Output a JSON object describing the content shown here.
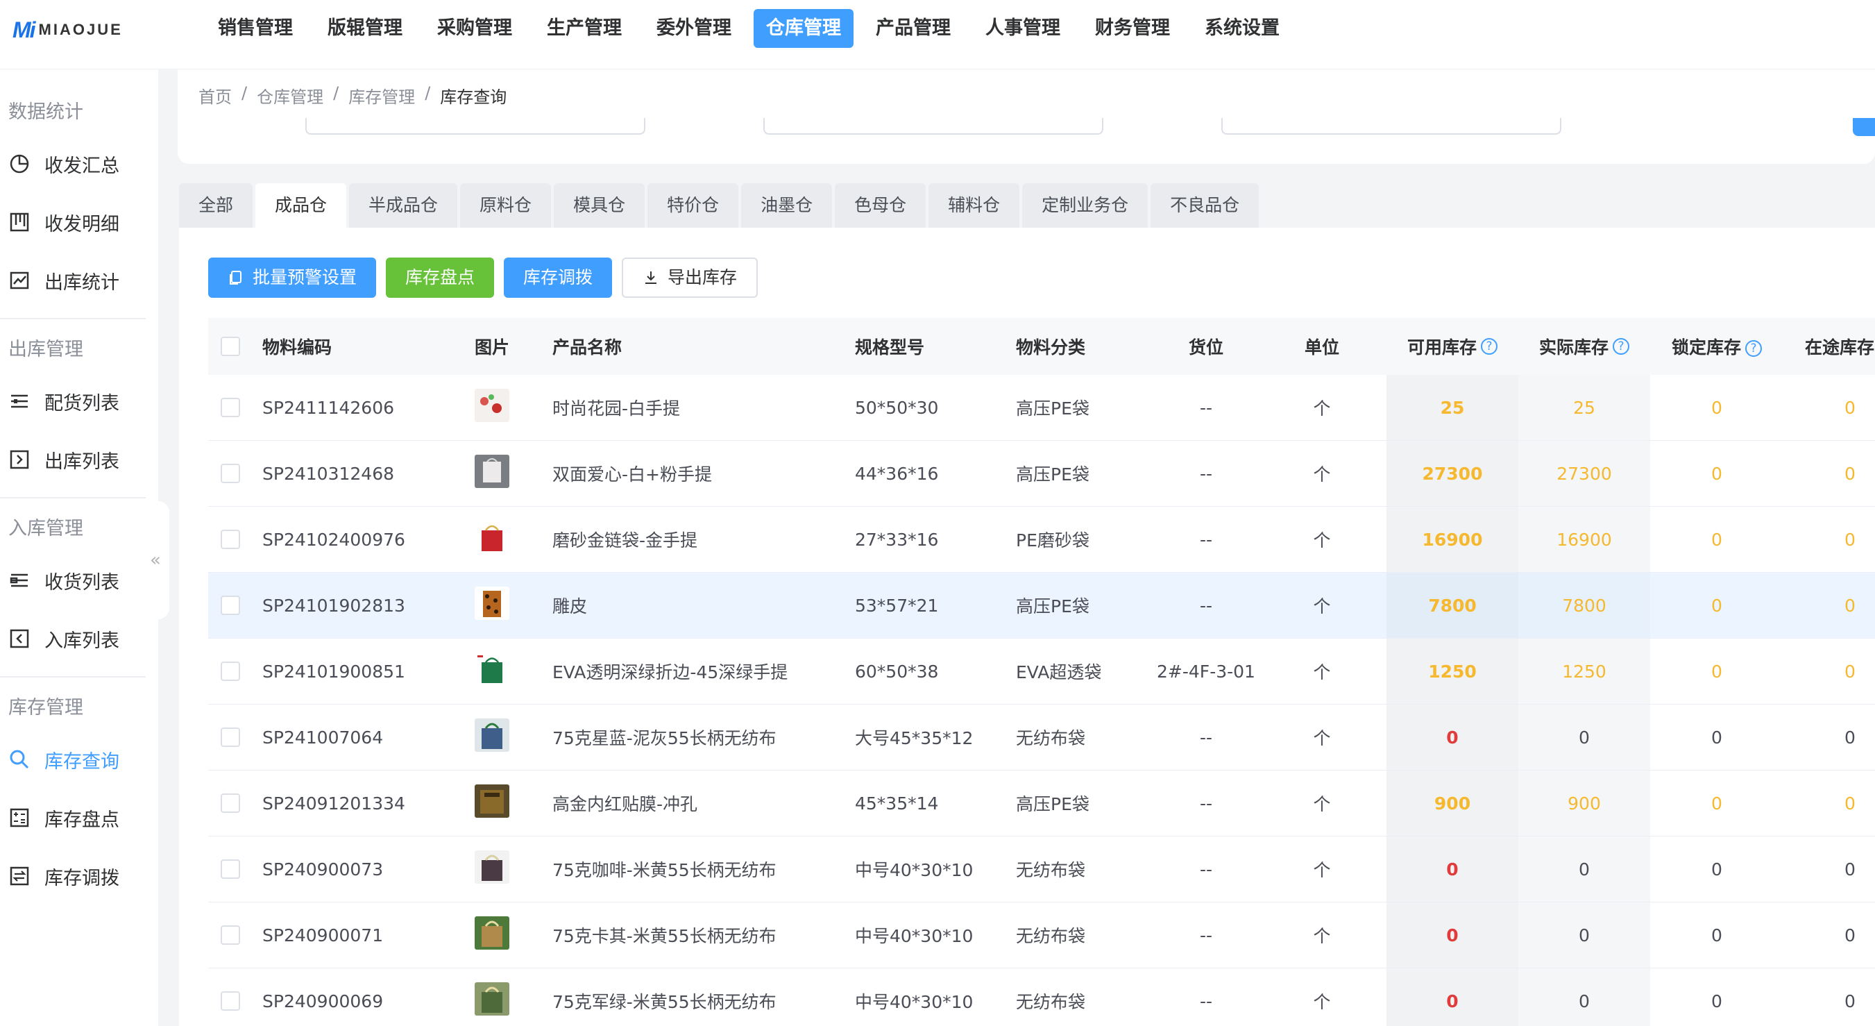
{
  "brand": {
    "mark": "Mi",
    "text": "MIAOJUE"
  },
  "nav": [
    {
      "label": "销售管理"
    },
    {
      "label": "版辊管理"
    },
    {
      "label": "采购管理"
    },
    {
      "label": "生产管理"
    },
    {
      "label": "委外管理"
    },
    {
      "label": "仓库管理"
    },
    {
      "label": "产品管理"
    },
    {
      "label": "人事管理"
    },
    {
      "label": "财务管理"
    },
    {
      "label": "系统设置"
    }
  ],
  "nav_active": "仓库管理",
  "sidebar": {
    "groups": [
      {
        "title": "数据统计",
        "items": [
          {
            "label": "收发汇总",
            "icon": "pie-chart-icon"
          },
          {
            "label": "收发明细",
            "icon": "detail-grid-icon"
          },
          {
            "label": "出库统计",
            "icon": "line-chart-icon"
          }
        ]
      },
      {
        "title": "出库管理",
        "items": [
          {
            "label": "配货列表",
            "icon": "list-icon"
          },
          {
            "label": "出库列表",
            "icon": "outbound-icon"
          }
        ]
      },
      {
        "title": "入库管理",
        "items": [
          {
            "label": "收货列表",
            "icon": "receive-list-icon"
          },
          {
            "label": "入库列表",
            "icon": "inbound-icon"
          }
        ]
      },
      {
        "title": "库存管理",
        "items": [
          {
            "label": "库存查询",
            "icon": "search-icon"
          },
          {
            "label": "库存盘点",
            "icon": "inventory-count-icon"
          },
          {
            "label": "库存调拨",
            "icon": "transfer-icon"
          }
        ]
      }
    ],
    "collapse": "«"
  },
  "breadcrumb": [
    "首页",
    "仓库管理",
    "库存管理",
    "库存查询"
  ],
  "breadcrumb_sep": "/",
  "tabs": [
    "全部",
    "成品仓",
    "半成品仓",
    "原料仓",
    "模具仓",
    "特价仓",
    "油墨仓",
    "色母仓",
    "辅料仓",
    "定制业务仓",
    "不良品仓"
  ],
  "tab_active": "成品仓",
  "toolbar": {
    "batch_alert": "批量预警设置",
    "stocktake": "库存盘点",
    "transfer": "库存调拨",
    "export": "导出库存"
  },
  "table": {
    "headers": {
      "code": "物料编码",
      "image": "图片",
      "name": "产品名称",
      "spec": "规格型号",
      "category": "物料分类",
      "location": "货位",
      "unit": "单位",
      "available": "可用库存",
      "actual": "实际库存",
      "locked": "锁定库存",
      "in_transit": "在途库存"
    },
    "help_mark": "?",
    "rows": [
      {
        "code": "SP2411142606",
        "name": "时尚花园-白手提",
        "spec": "50*50*30",
        "category": "高压PE袋",
        "location": "--",
        "unit": "个",
        "available": "25",
        "actual": "25",
        "locked": "0",
        "in_transit": "0"
      },
      {
        "code": "SP2410312468",
        "name": "双面爱心-白+粉手提",
        "spec": "44*36*16",
        "category": "高压PE袋",
        "location": "--",
        "unit": "个",
        "available": "27300",
        "actual": "27300",
        "locked": "0",
        "in_transit": "0"
      },
      {
        "code": "SP24102400976",
        "name": "磨砂金链袋-金手提",
        "spec": "27*33*16",
        "category": "PE磨砂袋",
        "location": "--",
        "unit": "个",
        "available": "16900",
        "actual": "16900",
        "locked": "0",
        "in_transit": "0"
      },
      {
        "code": "SP24101902813",
        "name": "雕皮",
        "spec": "53*57*21",
        "category": "高压PE袋",
        "location": "--",
        "unit": "个",
        "available": "7800",
        "actual": "7800",
        "locked": "0",
        "in_transit": "0"
      },
      {
        "code": "SP24101900851",
        "name": "EVA透明深绿折边-45深绿手提",
        "spec": "60*50*38",
        "category": "EVA超透袋",
        "location": "2#-4F-3-01",
        "unit": "个",
        "available": "1250",
        "actual": "1250",
        "locked": "0",
        "in_transit": "0"
      },
      {
        "code": "SP241007064",
        "name": "75克星蓝-泥灰55长柄无纺布",
        "spec": "大号45*35*12",
        "category": "无纺布袋",
        "location": "--",
        "unit": "个",
        "available": "0",
        "actual": "0",
        "locked": "0",
        "in_transit": "0"
      },
      {
        "code": "SP24091201334",
        "name": "高金内红贴膜-冲孔",
        "spec": "45*35*14",
        "category": "高压PE袋",
        "location": "--",
        "unit": "个",
        "available": "900",
        "actual": "900",
        "locked": "0",
        "in_transit": "0"
      },
      {
        "code": "SP240900073",
        "name": "75克咖啡-米黄55长柄无纺布",
        "spec": "中号40*30*10",
        "category": "无纺布袋",
        "location": "--",
        "unit": "个",
        "available": "0",
        "actual": "0",
        "locked": "0",
        "in_transit": "0"
      },
      {
        "code": "SP240900071",
        "name": "75克卡其-米黄55长柄无纺布",
        "spec": "中号40*30*10",
        "category": "无纺布袋",
        "location": "--",
        "unit": "个",
        "available": "0",
        "actual": "0",
        "locked": "0",
        "in_transit": "0"
      },
      {
        "code": "SP240900069",
        "name": "75克军绿-米黄55长柄无纺布",
        "spec": "中号40*30*10",
        "category": "无纺布袋",
        "location": "--",
        "unit": "个",
        "available": "0",
        "actual": "0",
        "locked": "0",
        "in_transit": "0"
      }
    ]
  },
  "colors": {
    "primary": "#409eff",
    "success": "#67c23a",
    "warning": "#f5b82e",
    "danger": "#e03c3c"
  }
}
